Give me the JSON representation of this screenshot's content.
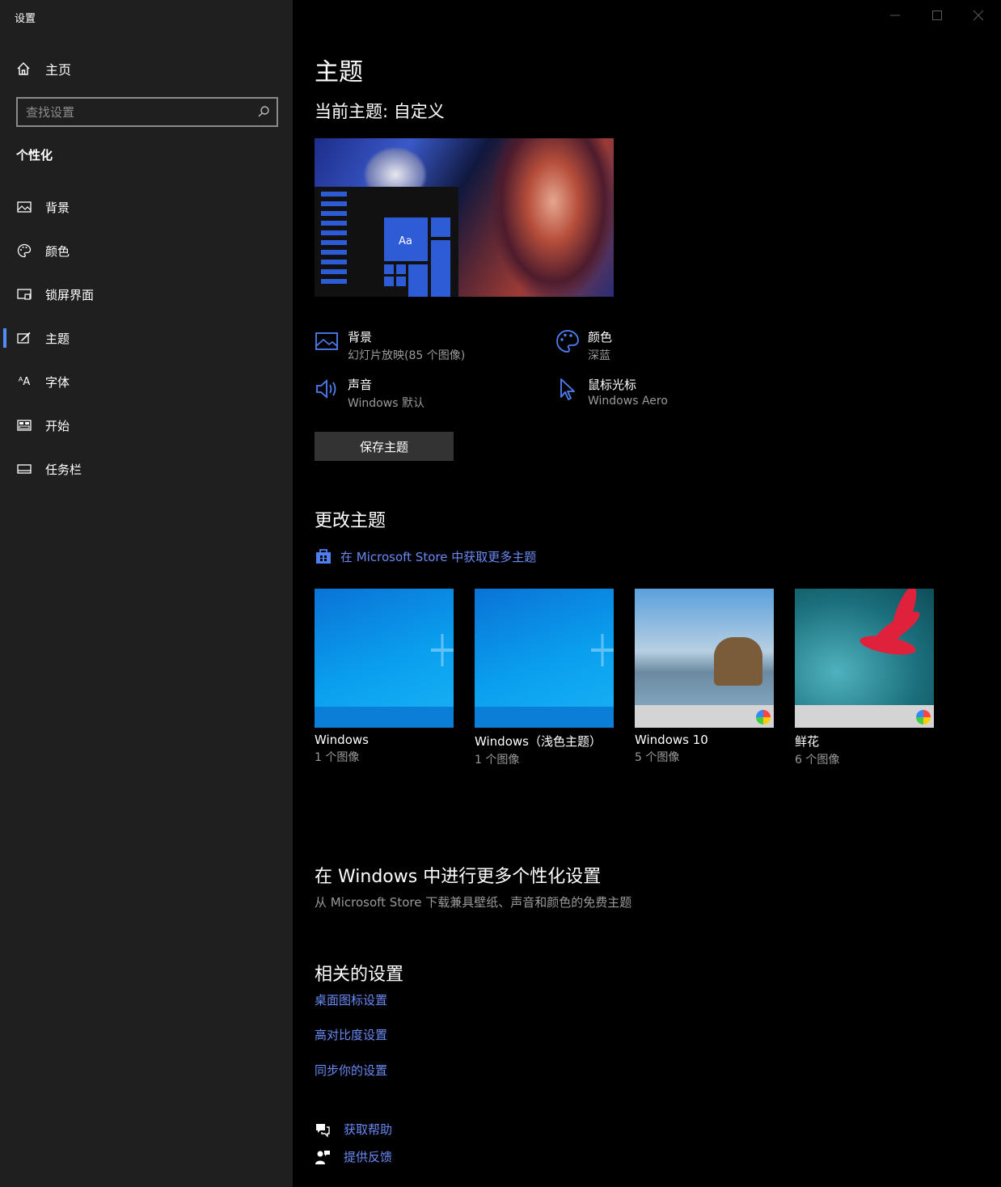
{
  "window": {
    "title": "设置"
  },
  "sidebar": {
    "home_label": "主页",
    "search_placeholder": "查找设置",
    "section_title": "个性化",
    "items": [
      {
        "label": "背景",
        "icon": "picture-icon"
      },
      {
        "label": "颜色",
        "icon": "palette-icon"
      },
      {
        "label": "锁屏界面",
        "icon": "lock-screen-icon"
      },
      {
        "label": "主题",
        "icon": "theme-brush-icon",
        "active": true
      },
      {
        "label": "字体",
        "icon": "font-icon"
      },
      {
        "label": "开始",
        "icon": "start-icon"
      },
      {
        "label": "任务栏",
        "icon": "taskbar-icon"
      }
    ]
  },
  "main": {
    "title": "主题",
    "current_theme": "当前主题: 自定义",
    "preview_tile_text": "Aa",
    "props": {
      "background": {
        "label": "背景",
        "value": "幻灯片放映(85 个图像)"
      },
      "color": {
        "label": "颜色",
        "value": "深蓝"
      },
      "sound": {
        "label": "声音",
        "value": "Windows 默认"
      },
      "cursor": {
        "label": "鼠标光标",
        "value": "Windows Aero"
      }
    },
    "save_button": "保存主题",
    "change_title": "更改主题",
    "store_link": "在 Microsoft Store 中获取更多主题",
    "themes": [
      {
        "name": "Windows",
        "count": "1 个图像"
      },
      {
        "name": "Windows（浅色主题）",
        "count": "1 个图像"
      },
      {
        "name": "Windows 10",
        "count": "5 个图像"
      },
      {
        "name": "鲜花",
        "count": "6 个图像"
      }
    ],
    "more_title": "在 Windows 中进行更多个性化设置",
    "more_sub": "从 Microsoft Store 下载兼具壁纸、声音和颜色的免费主题",
    "related_title": "相关的设置",
    "related_links": [
      "桌面图标设置",
      "高对比度设置",
      "同步你的设置"
    ],
    "help": "获取帮助",
    "feedback": "提供反馈"
  },
  "colors": {
    "accent": "#2e5bd6",
    "link": "#6a8af5",
    "sidebar_bg": "#1f1f1f"
  }
}
